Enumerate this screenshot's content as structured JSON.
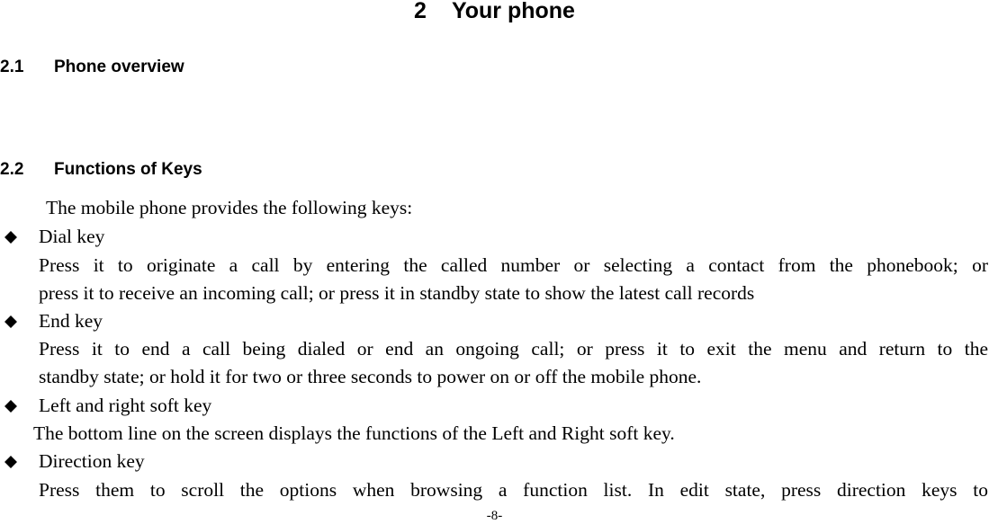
{
  "chapter": {
    "number": "2",
    "title": "Your phone"
  },
  "sections": [
    {
      "number": "2.1",
      "title": "Phone overview"
    },
    {
      "number": "2.2",
      "title": "Functions of Keys"
    }
  ],
  "intro": "The mobile phone provides the following keys:",
  "keys": [
    {
      "name": "Dial key",
      "lines": [
        "Press it to originate a call by entering the called number or selecting a contact from the phonebook; or",
        "press it to receive an incoming call; or press it in standby state to show the latest call records"
      ]
    },
    {
      "name": "End key",
      "lines": [
        "Press it to end a call being dialed or end an ongoing call; or press it to exit the menu and return to the",
        "standby state; or hold it for two or three seconds to power on or off the mobile phone."
      ]
    },
    {
      "name": "Left and right soft key",
      "lines": [
        "The bottom line on the screen displays the functions of the Left and Right soft key."
      ]
    },
    {
      "name": "Direction key",
      "lines": [
        "Press them to scroll the options when browsing a function list. In edit state, press direction keys to"
      ]
    }
  ],
  "footer": {
    "page_number": "-8-"
  }
}
